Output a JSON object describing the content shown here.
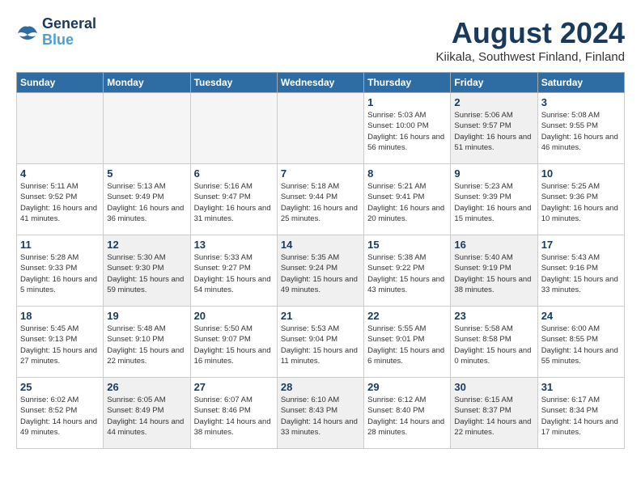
{
  "header": {
    "logo_line1": "General",
    "logo_line2": "Blue",
    "month": "August 2024",
    "location": "Kiikala, Southwest Finland, Finland"
  },
  "weekdays": [
    "Sunday",
    "Monday",
    "Tuesday",
    "Wednesday",
    "Thursday",
    "Friday",
    "Saturday"
  ],
  "weeks": [
    [
      {
        "day": "",
        "empty": true
      },
      {
        "day": "",
        "empty": true
      },
      {
        "day": "",
        "empty": true
      },
      {
        "day": "",
        "empty": true
      },
      {
        "day": "1",
        "sunrise": "5:03 AM",
        "sunset": "10:00 PM",
        "daylight": "16 hours and 56 minutes."
      },
      {
        "day": "2",
        "sunrise": "5:06 AM",
        "sunset": "9:57 PM",
        "daylight": "16 hours and 51 minutes."
      },
      {
        "day": "3",
        "sunrise": "5:08 AM",
        "sunset": "9:55 PM",
        "daylight": "16 hours and 46 minutes."
      }
    ],
    [
      {
        "day": "4",
        "sunrise": "5:11 AM",
        "sunset": "9:52 PM",
        "daylight": "16 hours and 41 minutes."
      },
      {
        "day": "5",
        "sunrise": "5:13 AM",
        "sunset": "9:49 PM",
        "daylight": "16 hours and 36 minutes."
      },
      {
        "day": "6",
        "sunrise": "5:16 AM",
        "sunset": "9:47 PM",
        "daylight": "16 hours and 31 minutes."
      },
      {
        "day": "7",
        "sunrise": "5:18 AM",
        "sunset": "9:44 PM",
        "daylight": "16 hours and 25 minutes."
      },
      {
        "day": "8",
        "sunrise": "5:21 AM",
        "sunset": "9:41 PM",
        "daylight": "16 hours and 20 minutes."
      },
      {
        "day": "9",
        "sunrise": "5:23 AM",
        "sunset": "9:39 PM",
        "daylight": "16 hours and 15 minutes."
      },
      {
        "day": "10",
        "sunrise": "5:25 AM",
        "sunset": "9:36 PM",
        "daylight": "16 hours and 10 minutes."
      }
    ],
    [
      {
        "day": "11",
        "sunrise": "5:28 AM",
        "sunset": "9:33 PM",
        "daylight": "16 hours and 5 minutes."
      },
      {
        "day": "12",
        "sunrise": "5:30 AM",
        "sunset": "9:30 PM",
        "daylight": "15 hours and 59 minutes."
      },
      {
        "day": "13",
        "sunrise": "5:33 AM",
        "sunset": "9:27 PM",
        "daylight": "15 hours and 54 minutes."
      },
      {
        "day": "14",
        "sunrise": "5:35 AM",
        "sunset": "9:24 PM",
        "daylight": "15 hours and 49 minutes."
      },
      {
        "day": "15",
        "sunrise": "5:38 AM",
        "sunset": "9:22 PM",
        "daylight": "15 hours and 43 minutes."
      },
      {
        "day": "16",
        "sunrise": "5:40 AM",
        "sunset": "9:19 PM",
        "daylight": "15 hours and 38 minutes."
      },
      {
        "day": "17",
        "sunrise": "5:43 AM",
        "sunset": "9:16 PM",
        "daylight": "15 hours and 33 minutes."
      }
    ],
    [
      {
        "day": "18",
        "sunrise": "5:45 AM",
        "sunset": "9:13 PM",
        "daylight": "15 hours and 27 minutes."
      },
      {
        "day": "19",
        "sunrise": "5:48 AM",
        "sunset": "9:10 PM",
        "daylight": "15 hours and 22 minutes."
      },
      {
        "day": "20",
        "sunrise": "5:50 AM",
        "sunset": "9:07 PM",
        "daylight": "15 hours and 16 minutes."
      },
      {
        "day": "21",
        "sunrise": "5:53 AM",
        "sunset": "9:04 PM",
        "daylight": "15 hours and 11 minutes."
      },
      {
        "day": "22",
        "sunrise": "5:55 AM",
        "sunset": "9:01 PM",
        "daylight": "15 hours and 6 minutes."
      },
      {
        "day": "23",
        "sunrise": "5:58 AM",
        "sunset": "8:58 PM",
        "daylight": "15 hours and 0 minutes."
      },
      {
        "day": "24",
        "sunrise": "6:00 AM",
        "sunset": "8:55 PM",
        "daylight": "14 hours and 55 minutes."
      }
    ],
    [
      {
        "day": "25",
        "sunrise": "6:02 AM",
        "sunset": "8:52 PM",
        "daylight": "14 hours and 49 minutes."
      },
      {
        "day": "26",
        "sunrise": "6:05 AM",
        "sunset": "8:49 PM",
        "daylight": "14 hours and 44 minutes."
      },
      {
        "day": "27",
        "sunrise": "6:07 AM",
        "sunset": "8:46 PM",
        "daylight": "14 hours and 38 minutes."
      },
      {
        "day": "28",
        "sunrise": "6:10 AM",
        "sunset": "8:43 PM",
        "daylight": "14 hours and 33 minutes."
      },
      {
        "day": "29",
        "sunrise": "6:12 AM",
        "sunset": "8:40 PM",
        "daylight": "14 hours and 28 minutes."
      },
      {
        "day": "30",
        "sunrise": "6:15 AM",
        "sunset": "8:37 PM",
        "daylight": "14 hours and 22 minutes."
      },
      {
        "day": "31",
        "sunrise": "6:17 AM",
        "sunset": "8:34 PM",
        "daylight": "14 hours and 17 minutes."
      }
    ]
  ]
}
